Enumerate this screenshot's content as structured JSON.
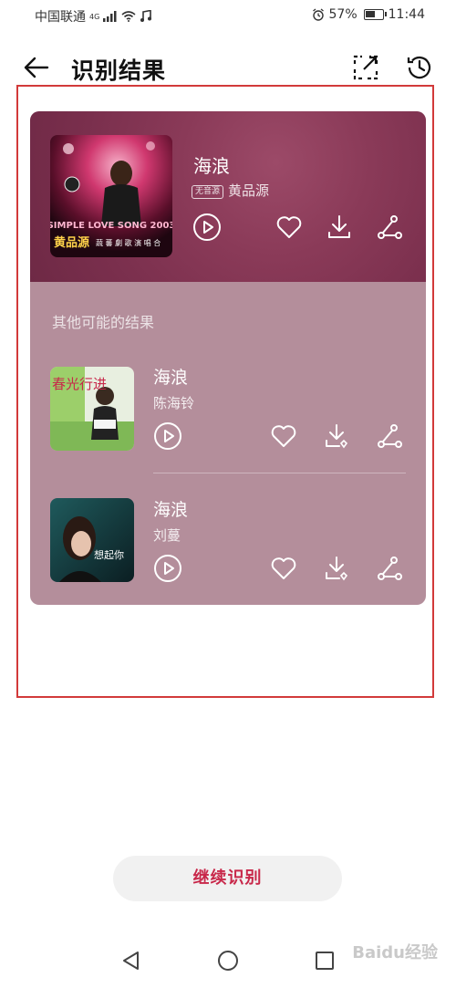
{
  "status_bar": {
    "carrier": "中国联通",
    "network": "4G",
    "battery_text": "57%",
    "battery_level": 0.57,
    "time": "11:44"
  },
  "header": {
    "title": "识别结果"
  },
  "main_result": {
    "title": "海浪",
    "tag": "无音源",
    "artist": "黄品源",
    "cover_text_line1": "SIMPLE LOVE SONG 2003",
    "cover_text_line2": "黄品源",
    "cover_text_line3": "蔬 蕃 劇 歌 演 唱 合"
  },
  "others": {
    "label": "其他可能的结果",
    "items": [
      {
        "title": "海浪",
        "artist": "陈海铃",
        "cover_text": "春光行进"
      },
      {
        "title": "海浪",
        "artist": "刘蔓",
        "cover_text": "想起你"
      }
    ]
  },
  "continue_button": {
    "label": "继续识别"
  },
  "watermark": "Baidu经验",
  "colors": {
    "accent": "#c8284a",
    "card_top": "#7a2f4d",
    "card_bottom": "#b48e9b",
    "frame": "#d23a3a"
  }
}
